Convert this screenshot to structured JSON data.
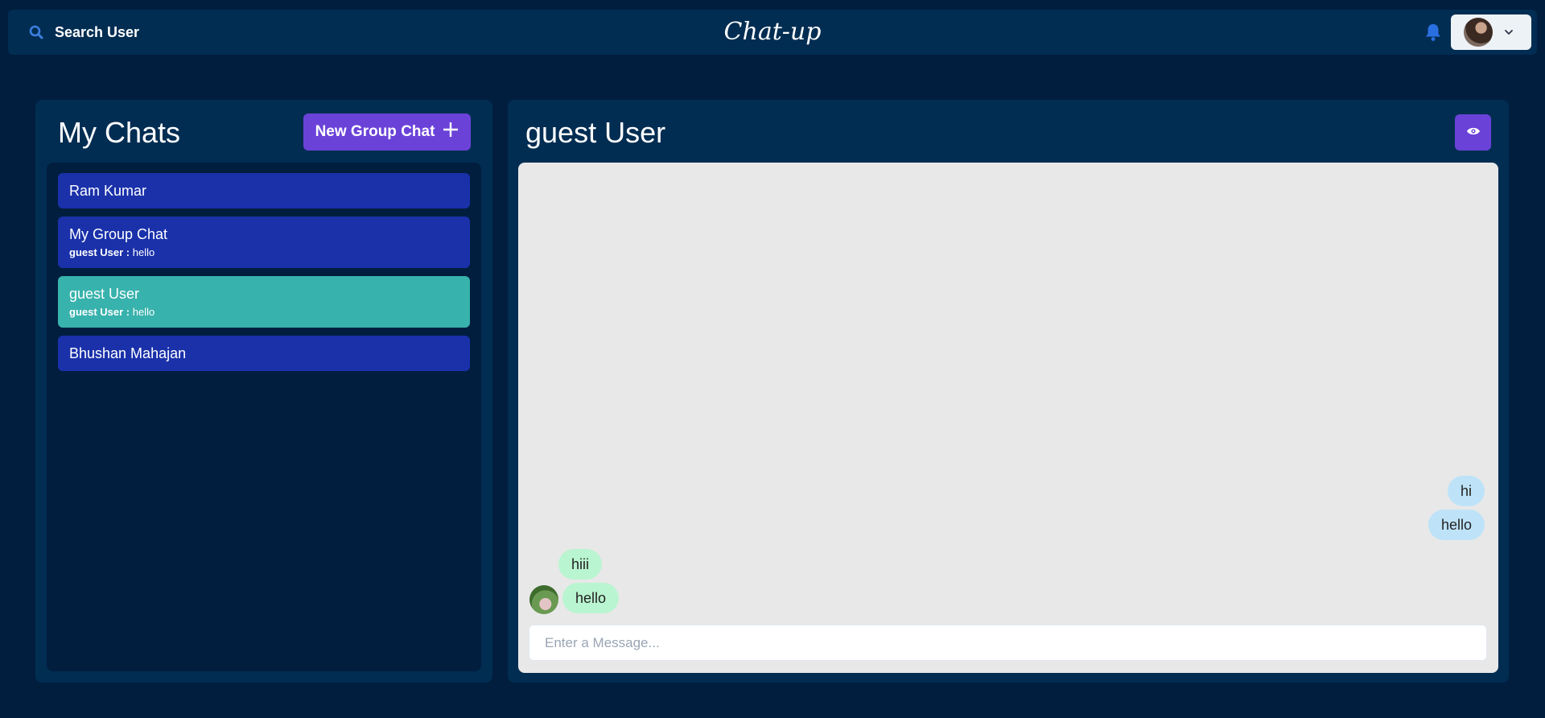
{
  "header": {
    "search_label": "Search User",
    "app_title": "Chat-up",
    "icons": {
      "search": "search-icon",
      "bell": "bell-icon",
      "chevron": "chevron-down-icon"
    }
  },
  "sidebar": {
    "title": "My Chats",
    "new_group_label": "New Group Chat",
    "chats": [
      {
        "name": "Ram Kumar",
        "sender": "",
        "message": "",
        "selected": false
      },
      {
        "name": "My Group Chat",
        "sender": "guest User :",
        "message": "hello",
        "selected": false
      },
      {
        "name": "guest User",
        "sender": "guest User :",
        "message": "hello",
        "selected": true
      },
      {
        "name": "Bhushan Mahajan",
        "sender": "",
        "message": "",
        "selected": false
      }
    ]
  },
  "chat": {
    "title": "guest User",
    "messages": [
      {
        "text": "hi",
        "mine": true
      },
      {
        "text": "hello",
        "mine": true
      },
      {
        "text": "hiii",
        "mine": false
      },
      {
        "text": "hello",
        "mine": false
      }
    ],
    "input_placeholder": "Enter a Message..."
  },
  "colors": {
    "background": "#011e3f",
    "panel": "#012d52",
    "chat_item": "#1a31aa",
    "chat_item_selected": "#38b2ac",
    "accent_button": "#6a42d8",
    "my_bubble": "#bee3f8",
    "their_bubble": "#b9f5d0"
  }
}
